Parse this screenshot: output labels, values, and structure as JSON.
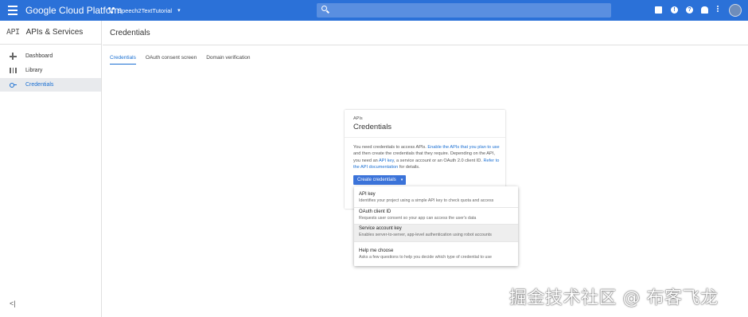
{
  "topbar": {
    "brand": "Google Cloud Platform",
    "project_name": "Speech2TextTutorial",
    "search_placeholder": "",
    "icons": [
      "menu-icon",
      "project-icon",
      "search-icon",
      "cloud-shell-icon",
      "alert-icon",
      "help-icon",
      "notifications-icon",
      "more-vert-icon",
      "account-avatar"
    ]
  },
  "sidebar": {
    "logo": "API",
    "title": "APIs & Services",
    "items": [
      {
        "label": "Dashboard",
        "icon": "dashboard-icon"
      },
      {
        "label": "Library",
        "icon": "library-icon"
      },
      {
        "label": "Credentials",
        "icon": "key-icon",
        "active": true
      }
    ],
    "collapse": "<|"
  },
  "main": {
    "title": "Credentials",
    "tabs": [
      {
        "label": "Credentials",
        "active": true
      },
      {
        "label": "OAuth consent screen"
      },
      {
        "label": "Domain verification"
      }
    ]
  },
  "card": {
    "eyebrow": "APIs",
    "title": "Credentials",
    "desc_1": "You need credentials to access APIs. ",
    "desc_link_1": "Enable the APIs that you plan to use",
    "desc_2": " and then create the credentials that they require. Depending on the API, you need an ",
    "desc_link_2": "API key",
    "desc_3": ", a service account or an OAuth 2.0 client ID. ",
    "desc_link_3": "Refer to the API documentation",
    "desc_4": " for details.",
    "button_label": "Create credentials",
    "button_caret": "▾"
  },
  "menu": {
    "items": [
      {
        "title": "API key",
        "desc": "Identifies your project using a simple API key to check quota and access"
      },
      {
        "title": "OAuth client ID",
        "desc": "Requests user consent so your app can access the user's data"
      },
      {
        "title": "Service account key",
        "desc": "Enables server-to-server, app-level authentication using robot accounts",
        "hover": true
      },
      {
        "title": "Help me choose",
        "desc": "Asks a few questions to help you decide which type of credential to use"
      }
    ]
  },
  "watermark": "掘金技术社区 @ 布客飞龙",
  "colors": {
    "topbar": "#2b71d8",
    "accent": "#1a6fd2",
    "button": "#3b73d9"
  }
}
